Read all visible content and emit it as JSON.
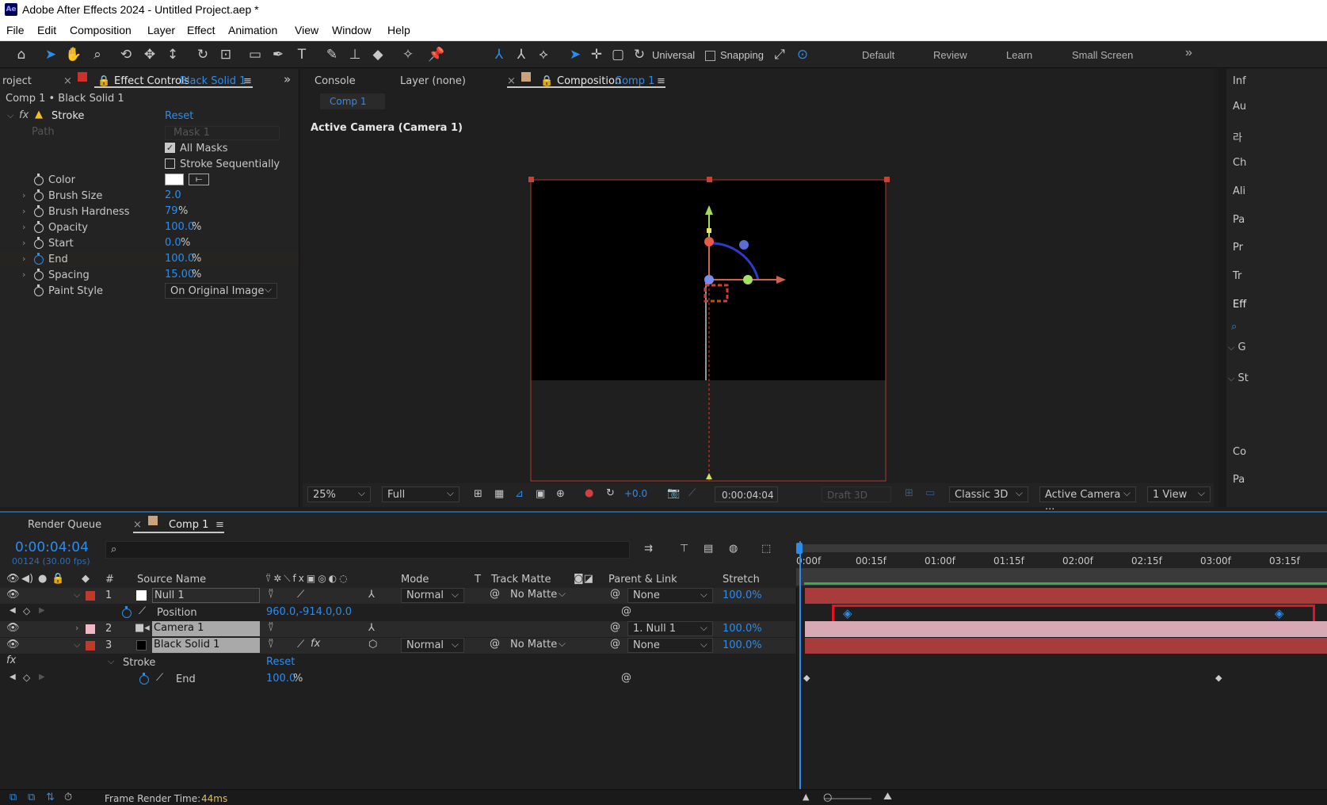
{
  "window": {
    "title": "Adobe After Effects 2024 - Untitled Project.aep *",
    "app_icon": "Ae"
  },
  "menu": [
    "File",
    "Edit",
    "Composition",
    "Layer",
    "Effect",
    "Animation",
    "View",
    "Window",
    "Help"
  ],
  "toolbar": {
    "universal_label": "Universal",
    "snapping_label": "Snapping",
    "workspaces": [
      "Default",
      "Review",
      "Learn",
      "Small Screen"
    ],
    "more": "»"
  },
  "left_panel": {
    "tab_project": "roject",
    "tab_effect_controls": "Effect Controls",
    "tab_effect_target": "Black Solid 1",
    "collapse": "»",
    "breadcrumb": "Comp 1 • Black Solid 1",
    "effect_name": "Stroke",
    "reset": "Reset",
    "path_label": "Path",
    "path_value": "Mask 1",
    "all_masks": "All Masks",
    "stroke_sequentially": "Stroke Sequentially",
    "properties": [
      {
        "label": "Color",
        "value": "",
        "unit": ""
      },
      {
        "label": "Brush Size",
        "value": "2.0",
        "unit": ""
      },
      {
        "label": "Brush Hardness",
        "value": "79",
        "unit": "%"
      },
      {
        "label": "Opacity",
        "value": "100.0",
        "unit": "%"
      },
      {
        "label": "Start",
        "value": "0.0",
        "unit": "%"
      },
      {
        "label": "End",
        "value": "100.0",
        "unit": "%"
      },
      {
        "label": "Spacing",
        "value": "15.00",
        "unit": "%"
      }
    ],
    "paint_style_label": "Paint Style",
    "paint_style_value": "On Original Image"
  },
  "comp_panel": {
    "tab_console": "Console",
    "tab_layer": "Layer (none)",
    "tab_composition": "Composition",
    "tab_comp_name": "Comp 1",
    "subtab": "Comp 1",
    "camera_label": "Active Camera (Camera 1)",
    "footer": {
      "zoom": "25%",
      "resolution": "Full",
      "exposure": "+0.0",
      "timecode": "0:00:04:04",
      "draft": "Draft 3D",
      "renderer": "Classic 3D",
      "view_camera": "Active Camera ...",
      "views": "1 View"
    }
  },
  "right_panel": {
    "items": [
      "Inf",
      "Au",
      "라",
      "Ch",
      "Ali",
      "Pa",
      "Pr",
      "Tr",
      "Eff",
      "",
      "G",
      "St",
      "Co",
      "Pa"
    ]
  },
  "timeline": {
    "tab_render_queue": "Render Queue",
    "tab_comp": "Comp 1",
    "timecode": "0:00:04:04",
    "frames": "00124 (30.00 fps)",
    "search_placeholder": "",
    "columns": {
      "hash": "#",
      "source_name": "Source Name",
      "mode": "Mode",
      "t": "T",
      "track_matte": "Track Matte",
      "parent_link": "Parent & Link",
      "stretch": "Stretch"
    },
    "ruler_labels": [
      "0:00f",
      "00:15f",
      "01:00f",
      "01:15f",
      "02:00f",
      "02:15f",
      "03:00f",
      "03:15f"
    ],
    "layers": [
      {
        "num": "1",
        "name": "Null 1",
        "mode": "Normal",
        "matte": "No Matte",
        "parent": "None",
        "stretch": "100.0%",
        "label_color": "#c0392b"
      },
      {
        "num": "2",
        "name": "Camera 1",
        "mode": "",
        "matte": "",
        "parent": "1. Null 1",
        "stretch": "100.0%",
        "label_color": "#f3b6c4"
      },
      {
        "num": "3",
        "name": "Black Solid 1",
        "mode": "Normal",
        "matte": "No Matte",
        "parent": "None",
        "stretch": "100.0%",
        "label_color": "#c0392b"
      }
    ],
    "position_prop": {
      "label": "Position",
      "value": "960.0,-914.0,0.0"
    },
    "stroke_prop": {
      "label": "Stroke",
      "reset": "Reset"
    },
    "end_prop": {
      "label": "End",
      "value": "100.0",
      "unit": "%"
    },
    "frame_render_label": "Frame Render Time:",
    "frame_render_value": "44ms"
  },
  "colors": {
    "accent": "#2d8ceb",
    "layer_red": "#a83c3c",
    "camera_pink": "#d8a8b4",
    "highlight_box": "#e81123"
  }
}
